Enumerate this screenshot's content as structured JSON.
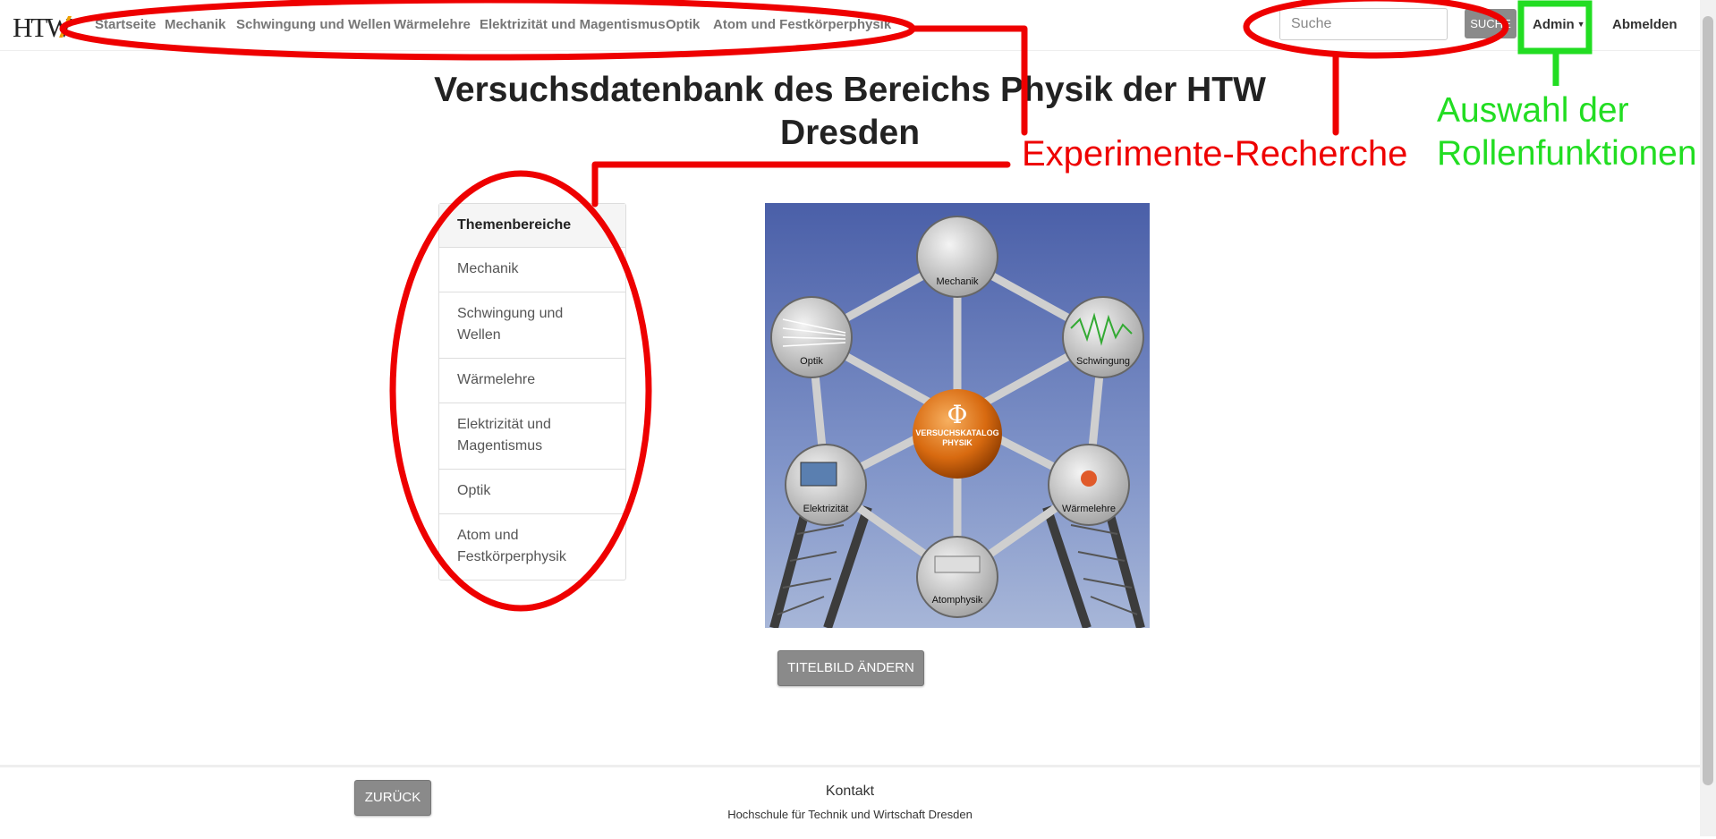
{
  "navbar": {
    "logo_text": "HTW",
    "links": [
      "Startseite",
      "Mechanik",
      "Schwingung und Wellen",
      "Wärmelehre",
      "Elektrizität und Magentismus",
      "Optik",
      "Atom und Festkörperphysik"
    ],
    "search_placeholder": "Suche",
    "search_button": "SUCHE",
    "admin_label": "Admin",
    "logout_label": "Abmelden"
  },
  "main": {
    "title": "Versuchsdatenbank des Bereichs Physik der HTW Dresden",
    "sidebar": {
      "heading": "Themenbereiche",
      "items": [
        "Mechanik",
        "Schwingung und Wellen",
        "Wärmelehre",
        "Elektrizität und Magentismus",
        "Optik",
        "Atom und Festkörperphysik"
      ]
    },
    "hero": {
      "center_symbol": "Φ",
      "center_line1": "VERSUCHSKATALOG",
      "center_line2": "PHYSIK",
      "nodes": [
        "Mechanik",
        "Schwingung",
        "Wärmelehre",
        "Atomphysik",
        "Elektrizität",
        "Optik"
      ]
    },
    "change_image_button": "TITELBILD ÄNDERN"
  },
  "footer": {
    "back_button": "ZURÜCK",
    "contact": "Kontakt",
    "company": "Hochschule für Technik und Wirtschaft Dresden"
  },
  "annotations": {
    "red_label": "Experimente-Recherche",
    "green_label": "Auswahl der Rollenfunktionen"
  },
  "colors": {
    "annotation_red": "#e00000",
    "annotation_green": "#22dd22",
    "button_gray": "#8a8a8a",
    "logo_orange": "#f0a000"
  }
}
